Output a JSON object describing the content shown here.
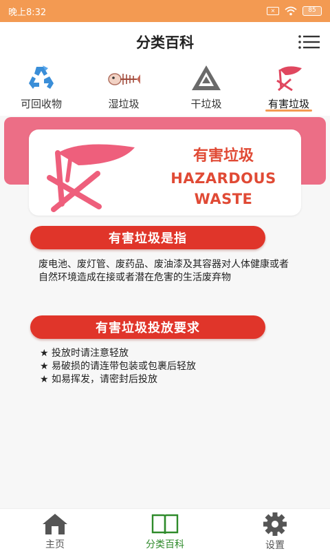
{
  "status_bar": {
    "time": "晚上8:32",
    "battery": "85"
  },
  "header": {
    "title": "分类百科"
  },
  "tabs": [
    {
      "label": "可回收物",
      "icon": "recycle-icon"
    },
    {
      "label": "湿垃圾",
      "icon": "fishbone-icon"
    },
    {
      "label": "干垃圾",
      "icon": "dry-waste-icon"
    },
    {
      "label": "有害垃圾",
      "icon": "hazardous-icon",
      "active": true
    }
  ],
  "banner": {
    "title_cn": "有害垃圾",
    "title_en_1": "HAZARDOUS",
    "title_en_2": "WASTE"
  },
  "definition": {
    "heading": "有害垃圾是指",
    "text": "废电池、废灯管、废药品、废油漆及其容器对人体健康或者自然环境造成在接或者潜在危害的生活废弃物"
  },
  "requirements": {
    "heading": "有害垃圾投放要求",
    "items": [
      "★ 投放时请注意轻放",
      "★ 易破损的请连带包装或包裹后轻放",
      "★ 如易挥发，请密封后投放"
    ]
  },
  "bottom_nav": [
    {
      "label": "主页",
      "icon": "home-icon"
    },
    {
      "label": "分类百科",
      "icon": "book-icon",
      "active": true
    },
    {
      "label": "设置",
      "icon": "gear-icon"
    }
  ],
  "colors": {
    "accent": "#f39a52",
    "hazard_pink": "#ec6e86",
    "pill_red": "#e0352a",
    "nav_active": "#2e8a2a"
  }
}
